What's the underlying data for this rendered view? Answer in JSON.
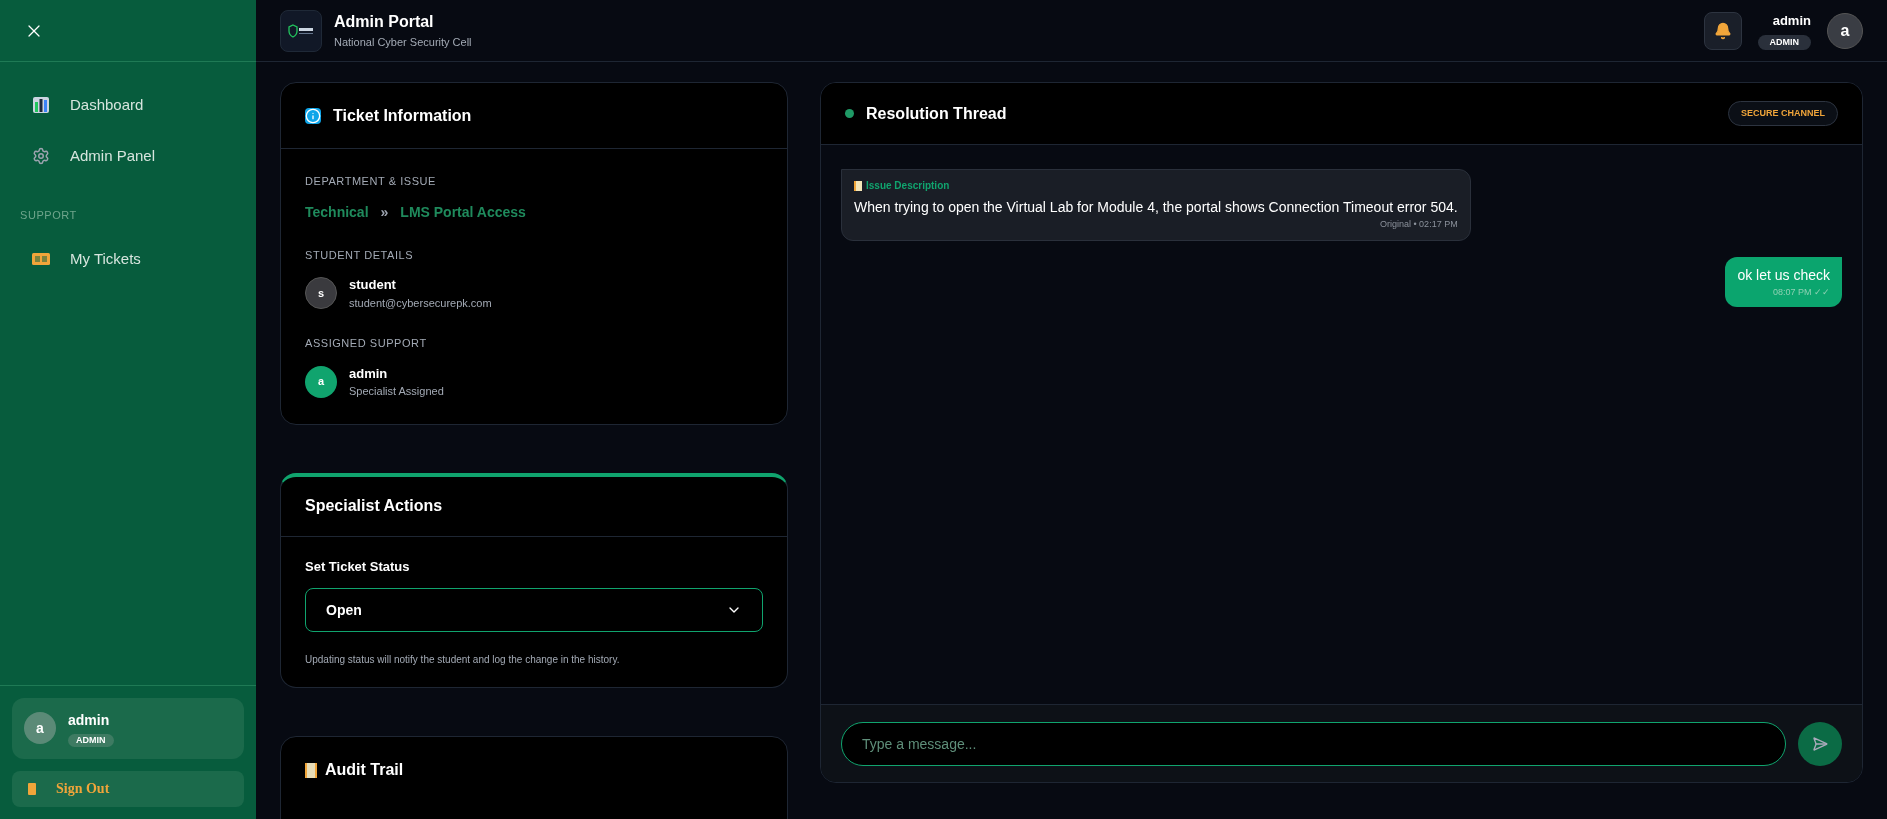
{
  "sidebar": {
    "nav": [
      {
        "label": "Dashboard",
        "kind": "chart",
        "selected": false
      },
      {
        "label": "Admin Panel",
        "kind": "gear",
        "selected": false
      }
    ],
    "section": "SUPPORT",
    "support_nav": [
      {
        "label": "My Tickets",
        "kind": "ticket",
        "selected": false
      }
    ],
    "user": {
      "avatar": "a",
      "name": "admin",
      "role": "ADMIN"
    },
    "sign_out": "Sign Out"
  },
  "header": {
    "title": "Admin Portal",
    "subtitle": "National Cyber Security Cell",
    "user": {
      "name": "admin",
      "role": "ADMIN",
      "avatar": "a"
    }
  },
  "ticket_info": {
    "title": "Ticket Information",
    "department_label": "DEPARTMENT & ISSUE",
    "department": "Technical",
    "separator": "»",
    "issue": "LMS Portal Access",
    "student_label": "STUDENT DETAILS",
    "student": {
      "avatar": "s",
      "name": "student",
      "email": "student@cybersecurepk.com"
    },
    "support_label": "ASSIGNED SUPPORT",
    "support": {
      "avatar": "a",
      "name": "admin",
      "note": "Specialist Assigned"
    }
  },
  "actions": {
    "title": "Specialist Actions",
    "status_label": "Set Ticket Status",
    "status_value": "Open",
    "hint": "Updating status will notify the student and log the change in the history."
  },
  "audit": {
    "title": "Audit Trail"
  },
  "thread": {
    "title": "Resolution Thread",
    "badge": "SECURE CHANNEL",
    "messages": [
      {
        "kind": "incoming",
        "heading": "Issue Description",
        "text": "When trying to open the Virtual Lab for Module 4, the portal shows Connection Timeout error 504.",
        "meta": "Original • 02:17 PM"
      },
      {
        "kind": "outgoing",
        "text": "ok let us check",
        "meta": "08:07 PM ✓✓"
      }
    ],
    "input": {
      "placeholder": "Type a message..."
    }
  }
}
